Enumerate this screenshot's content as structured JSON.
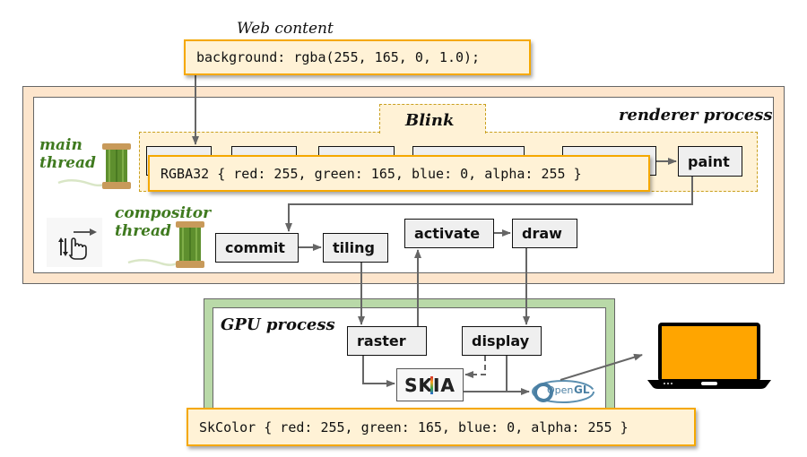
{
  "web_content": {
    "title": "Web content",
    "css_code": "background: rgba(255, 165, 0, 1.0);"
  },
  "renderer_process": {
    "label": "renderer process",
    "blink_label": "Blink",
    "main_thread_label_line1": "main",
    "main_thread_label_line2": "thread",
    "compositor_thread_label_line1": "compositor",
    "compositor_thread_label_line2": "thread",
    "rgba_code": "RGBA32 { red: 255, green: 165, blue: 0, alpha: 255 }",
    "stages": {
      "paint": "paint",
      "commit": "commit",
      "tiling": "tiling",
      "activate": "activate",
      "draw": "draw"
    }
  },
  "gpu_process": {
    "label": "GPU process",
    "stages": {
      "raster": "raster",
      "display": "display"
    },
    "skia_logo": "SKIA",
    "opengl_logo_open": "Open",
    "opengl_logo_gl": "GL",
    "skcolor_code": "SkColor { red: 255, green: 165, blue: 0, alpha: 255 }"
  },
  "icons": {
    "spool": "thread-spool",
    "gesture": "scroll-gesture",
    "laptop": "laptop"
  },
  "colors": {
    "rendered_color": "#ffa500",
    "renderer_frame": "#fde5cc",
    "gpu_frame": "#b9d9a8",
    "code_box_bg": "#fff2d6",
    "code_box_border": "#f5a800",
    "thread_label": "#3f7a1f"
  }
}
